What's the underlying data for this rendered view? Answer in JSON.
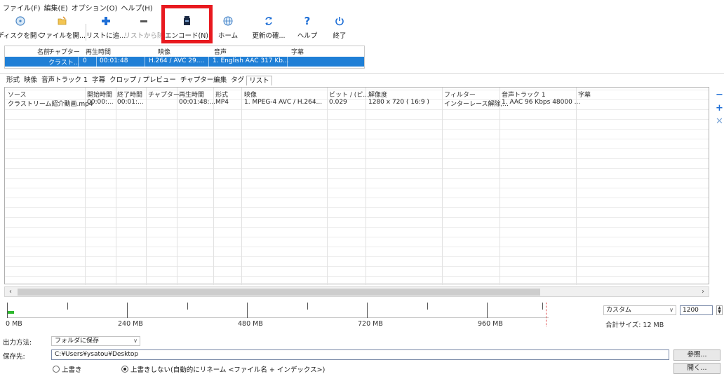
{
  "menu": [
    "ファイル(F)",
    "編集(E)",
    "オプション(O)",
    "ヘルプ(H)"
  ],
  "toolbar": {
    "open_disc": "ディスクを開く",
    "open_file": "ファイルを開...",
    "add_list": "リストに追...",
    "remove_list": "リストから除",
    "encode": "エンコード(N)",
    "home": "ホーム",
    "update": "更新の確...",
    "help": "ヘルプ",
    "exit": "終了"
  },
  "title_list": {
    "headers": [
      "名前",
      "チャプター",
      "再生時間",
      "映像",
      "音声",
      "字幕"
    ],
    "row": [
      "クラスト...",
      "0",
      "00:01:48",
      "H.264 / AVC 29....",
      "1. English AAC 317 Kb..."
    ]
  },
  "tabs": [
    "形式",
    "映像",
    "音声トラック 1",
    "字幕",
    "クロップ / プレビュー",
    "チャプター編集",
    "タグ",
    "リスト"
  ],
  "grid": {
    "headers": [
      "ソース",
      "開始時間",
      "終了時間",
      "チャプター",
      "再生時間",
      "形式",
      "映像",
      "ビット / (ピ...",
      "解像度",
      "フィルター",
      "音声トラック 1",
      "字幕"
    ],
    "rows": [
      [
        "クラストリーム紹介動画.mp4",
        "00:00:...",
        "00:01:...",
        "",
        "00:01:48:...",
        "MP4",
        "1. MPEG-4 AVC / H.264...",
        "0.029",
        "1280 x 720 ( 16:9 )",
        "インターレース解除,...",
        "1. AAC 96 Kbps 48000 ...",
        ""
      ]
    ]
  },
  "ruler": {
    "labels": [
      "0 MB",
      "240 MB",
      "480 MB",
      "720 MB",
      "960 MB"
    ],
    "used_fraction": 0.01
  },
  "size": {
    "mode": "カスタム",
    "value": "1200",
    "total": "合計サイズ: 12 MB"
  },
  "output": {
    "method_label": "出力方法:",
    "method_value": "フォルダに保存",
    "dest_label": "保存先:",
    "dest_value": "C:¥Users¥ysatou¥Desktop",
    "browse": "参照...",
    "open": "開く...",
    "radio_overwrite": "上書き",
    "radio_rename": "上書きしない(自動的にリネーム <ファイル名 + インデックス>)"
  },
  "colors": {
    "selection": "#1f7fd6",
    "highlight": "#e8191f",
    "accent_add": "#1f6fd6"
  },
  "icons": [
    "disc-icon",
    "folder-open-icon",
    "plus-icon",
    "minus-icon",
    "encode-icon",
    "globe-icon",
    "refresh-icon",
    "question-icon",
    "power-icon"
  ]
}
